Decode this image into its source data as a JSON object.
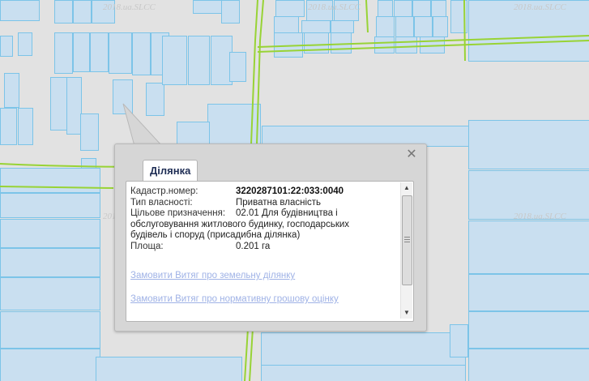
{
  "map": {
    "watermark": "2018.ua.SLCC",
    "colors": {
      "background": "#e2e2e2",
      "parcel_fill": "#c9dff0",
      "parcel_stroke": "#7cc4e8",
      "road": "#98d335"
    }
  },
  "popup": {
    "tab_title": "Ділянка",
    "close_icon": "close-icon",
    "fields": [
      {
        "label": "Кадастр.номер:",
        "value": "3220287101:22:033:0040",
        "bold": true
      },
      {
        "label": "Тип власності:",
        "value": "Приватна власність",
        "bold": false
      }
    ],
    "purpose": {
      "label": "Цільове призначення:",
      "lines": [
        "02.01 Для будівництва і",
        "обслуговування житлового будинку, господарських",
        "будівель і споруд (присадибна ділянка)"
      ]
    },
    "area": {
      "label": "Площа:",
      "value": "0.201 га"
    },
    "links": [
      "Замовити Витяг про земельну ділянку",
      "Замовити Витяг про нормативну грошову оцінку"
    ]
  }
}
